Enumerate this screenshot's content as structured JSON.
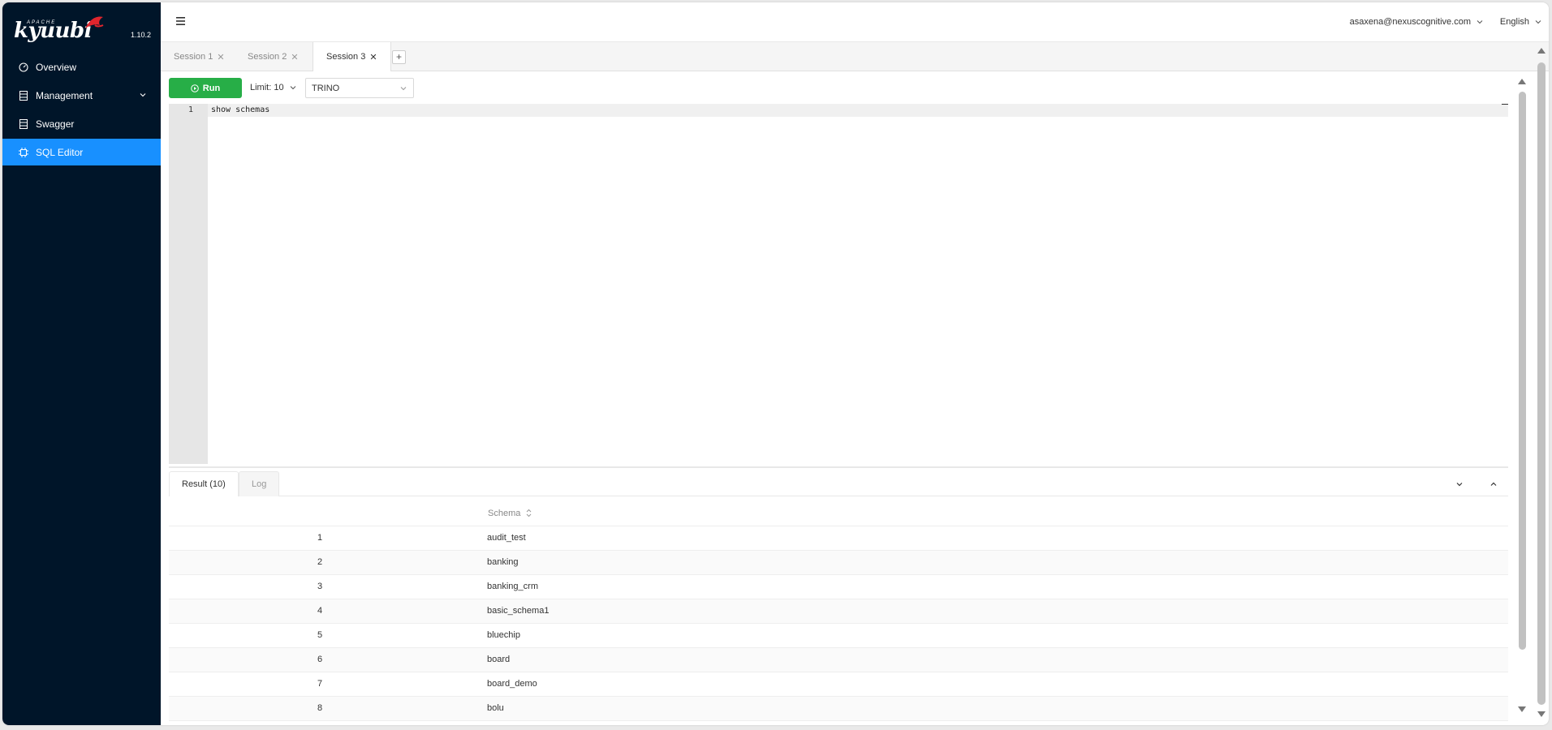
{
  "app": {
    "logo_small": "APACHE",
    "logo_text": "kyuubi",
    "version": "1.10.2"
  },
  "sidebar": {
    "items": [
      {
        "label": "Overview",
        "icon": "gauge-icon"
      },
      {
        "label": "Management",
        "icon": "database-icon"
      },
      {
        "label": "Swagger",
        "icon": "file-icon"
      },
      {
        "label": "SQL Editor",
        "icon": "chip-icon",
        "active": true
      }
    ]
  },
  "header": {
    "user": "asaxena@nexuscognitive.com",
    "language": "English"
  },
  "sessions": {
    "tabs": [
      {
        "label": "Session 1"
      },
      {
        "label": "Session 2"
      },
      {
        "label": "Session 3",
        "active": true
      }
    ],
    "add_label": "+"
  },
  "toolbar": {
    "run_label": "Run",
    "limit_label": "Limit: 10",
    "engine": "TRINO"
  },
  "editor": {
    "line_number": "1",
    "code": "show schemas"
  },
  "results": {
    "result_tab": "Result (10)",
    "log_tab": "Log",
    "column": "Schema",
    "rows": [
      {
        "idx": "1",
        "schema": "audit_test"
      },
      {
        "idx": "2",
        "schema": "banking"
      },
      {
        "idx": "3",
        "schema": "banking_crm"
      },
      {
        "idx": "4",
        "schema": "basic_schema1"
      },
      {
        "idx": "5",
        "schema": "bluechip"
      },
      {
        "idx": "6",
        "schema": "board"
      },
      {
        "idx": "7",
        "schema": "board_demo"
      },
      {
        "idx": "8",
        "schema": "bolu"
      }
    ]
  },
  "colors": {
    "sidebar_bg": "#001529",
    "active_item": "#1890ff",
    "run_button": "#27ae47"
  }
}
